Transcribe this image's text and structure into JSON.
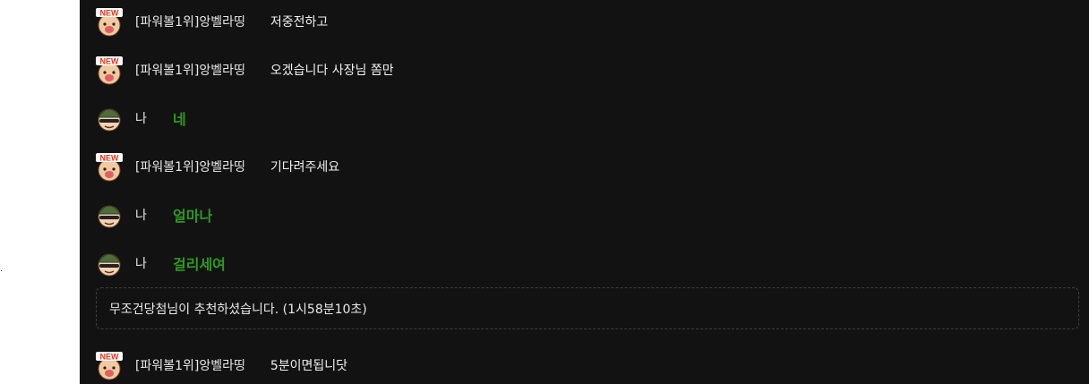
{
  "gutter": {
    "marker": "."
  },
  "messages": [
    {
      "sender": "[파워볼1위]앙벨라띵",
      "text": "저중전하고",
      "mine": false
    },
    {
      "sender": "[파워볼1위]앙벨라띵",
      "text": "오겠습니다 사장님 쫌만",
      "mine": false
    },
    {
      "sender": "나",
      "text": "네",
      "mine": true
    },
    {
      "sender": "[파워볼1위]앙벨라띵",
      "text": "기다려주세요",
      "mine": false
    },
    {
      "sender": "나",
      "text": "얼마나",
      "mine": true
    },
    {
      "sender": "나",
      "text": "걸리세여",
      "mine": true
    }
  ],
  "system_notice": {
    "text": "무조건당첨님이 추천하셨습니다. (1시58분10초)"
  },
  "last_message": {
    "sender": "[파워볼1위]앙벨라띵",
    "text": "5분이면됩니닷",
    "mine": false
  },
  "avatar_badge": "NEW",
  "colors": {
    "panel_bg": "#121212",
    "my_text": "#2d9a1f",
    "other_text": "#f0f0f0"
  }
}
